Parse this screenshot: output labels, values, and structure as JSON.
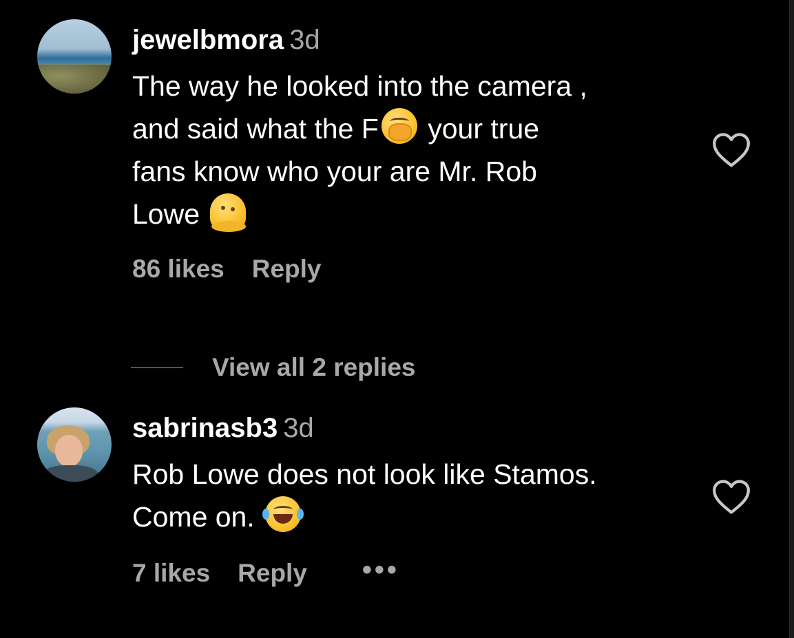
{
  "comments": [
    {
      "username": "jewelbmora",
      "time": "3d",
      "text_line_1": "The way he looked into the camera ,",
      "text_line_2a": "and said what the F",
      "text_line_2b": "your true",
      "text_line_3": "fans know who your are Mr. Rob",
      "text_line_4": "Lowe",
      "likes": "86 likes",
      "reply": "Reply",
      "view_replies": "View all 2 replies"
    },
    {
      "username": "sabrinasb3",
      "time": "3d",
      "text_line_1": "Rob Lowe does not look like Stamos.",
      "text_line_2": "Come on.",
      "likes": "7 likes",
      "reply": "Reply",
      "more": "•••"
    }
  ],
  "icons": {
    "like": "heart-outline-icon",
    "emoji_1": "face-with-hand-over-mouth-emoji",
    "emoji_2": "melting-face-emoji",
    "emoji_3": "face-with-tears-of-joy-emoji"
  },
  "colors": {
    "background": "#000000",
    "primary_text": "#ffffff",
    "secondary_text": "#a8a8a8"
  }
}
